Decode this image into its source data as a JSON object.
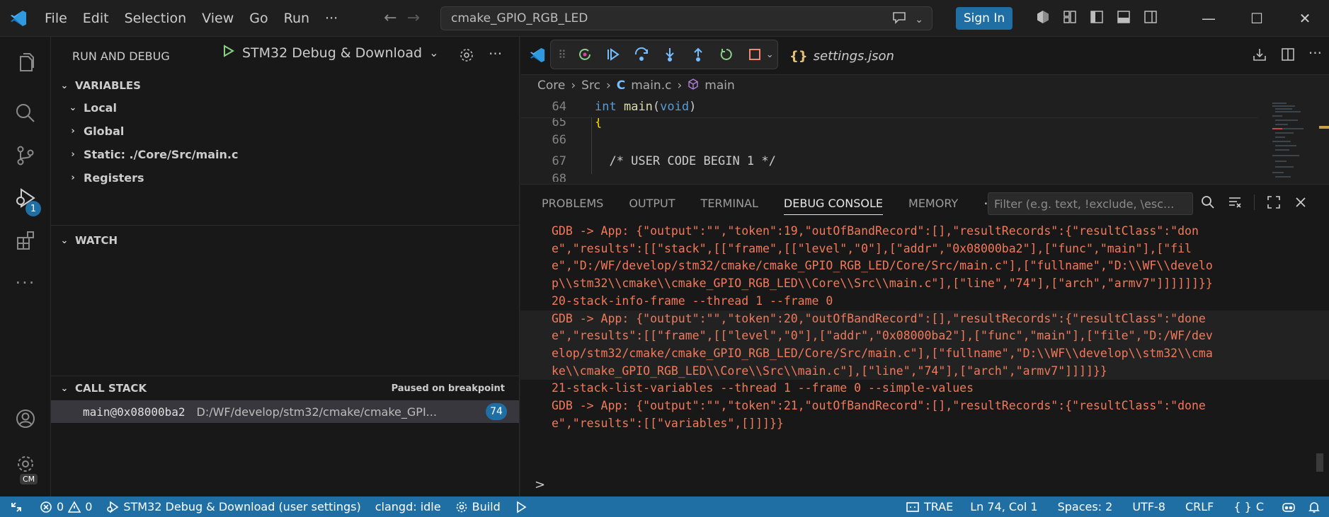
{
  "titlebar": {
    "menu": [
      "File",
      "Edit",
      "Selection",
      "View",
      "Go",
      "Run",
      "···"
    ],
    "search_text": "cmake_GPIO_RGB_LED",
    "sign_in": "Sign In",
    "window_controls": [
      "—",
      "☐",
      "✕"
    ]
  },
  "sidebar": {
    "title": "RUN AND DEBUG",
    "config": "STM32 Debug & Download",
    "sections": {
      "variables": "VARIABLES",
      "watch": "WATCH",
      "callstack": "CALL STACK",
      "paused": "Paused on breakpoint"
    },
    "variables": [
      "Local",
      "Global",
      "Static: ./Core/Src/main.c",
      "Registers"
    ],
    "callstack_row": {
      "func": "main@0x08000ba2",
      "path": "D:/WF/develop/stm32/cmake/cmake_GPI...",
      "line": "74"
    },
    "debug_badge": "1",
    "account_badge": "CM"
  },
  "editor": {
    "tab": "settings.json",
    "breadcrumb": [
      "Core",
      "Src",
      "main.c",
      "main"
    ],
    "lines": [
      {
        "num": "64",
        "text": "int main(void)"
      },
      {
        "num": "65",
        "text": "{"
      },
      {
        "num": "66",
        "text": ""
      },
      {
        "num": "67",
        "text": "  /* USER CODE BEGIN 1 */"
      },
      {
        "num": "68",
        "text": ""
      }
    ]
  },
  "panel": {
    "tabs": [
      "PROBLEMS",
      "OUTPUT",
      "TERMINAL",
      "DEBUG CONSOLE",
      "MEMORY",
      "···"
    ],
    "active_tab": "DEBUG CONSOLE",
    "filter_placeholder": "Filter (e.g. text, !exclude, \\esc...",
    "console": [
      {
        "color": "red",
        "hl": false,
        "text": "GDB -> App: {\"output\":\"\",\"token\":19,\"outOfBandRecord\":[],\"resultRecords\":{\"resultClass\":\"don"
      },
      {
        "color": "red",
        "hl": false,
        "text": "e\",\"results\":[[\"stack\",[[\"frame\",[[\"level\",\"0\"],[\"addr\",\"0x08000ba2\"],[\"func\",\"main\"],[\"fil"
      },
      {
        "color": "red",
        "hl": false,
        "text": "e\",\"D:/WF/develop/stm32/cmake/cmake_GPIO_RGB_LED/Core/Src/main.c\"],[\"fullname\",\"D:\\\\WF\\\\develo"
      },
      {
        "color": "red",
        "hl": false,
        "text": "p\\\\stm32\\\\cmake\\\\cmake_GPIO_RGB_LED\\\\Core\\\\Src\\\\main.c\"],[\"line\",\"74\"],[\"arch\",\"armv7\"]]]]]]}}"
      },
      {
        "color": "red",
        "hl": false,
        "text": "20-stack-info-frame --thread 1 --frame 0"
      },
      {
        "color": "red",
        "hl": true,
        "text": "GDB -> App: {\"output\":\"\",\"token\":20,\"outOfBandRecord\":[],\"resultRecords\":{\"resultClass\":\"done"
      },
      {
        "color": "red",
        "hl": true,
        "text": "e\",\"results\":[[\"frame\",[[\"level\",\"0\"],[\"addr\",\"0x08000ba2\"],[\"func\",\"main\"],[\"file\",\"D:/WF/dev"
      },
      {
        "color": "red",
        "hl": true,
        "text": "elop/stm32/cmake/cmake_GPIO_RGB_LED/Core/Src/main.c\"],[\"fullname\",\"D:\\\\WF\\\\develop\\\\stm32\\\\cma"
      },
      {
        "color": "red",
        "hl": true,
        "text": "ke\\\\cmake_GPIO_RGB_LED\\\\Core\\\\Src\\\\main.c\"],[\"line\",\"74\"],[\"arch\",\"armv7\"]]]]}}"
      },
      {
        "color": "red",
        "hl": false,
        "text": "21-stack-list-variables --thread 1 --frame 0 --simple-values"
      },
      {
        "color": "red",
        "hl": false,
        "text": "GDB -> App: {\"output\":\"\",\"token\":21,\"outOfBandRecord\":[],\"resultRecords\":{\"resultClass\":\"done"
      },
      {
        "color": "red",
        "hl": false,
        "text": "e\",\"results\":[[\"variables\",[]]]}}"
      }
    ],
    "prompt": ">"
  },
  "statusbar": {
    "errors": "0",
    "warnings": "0",
    "debug_config": "STM32 Debug & Download (user settings)",
    "clangd": "clangd: idle",
    "build": "Build",
    "trae": "TRAE",
    "position": "Ln 74, Col 1",
    "spaces": "Spaces: 2",
    "encoding": "UTF-8",
    "eol": "CRLF",
    "language": "C"
  },
  "colors": {
    "accent": "#1f6fa5",
    "console_red": "#f2795a",
    "keyword": "#569cd6",
    "function": "#dcdcaa"
  }
}
